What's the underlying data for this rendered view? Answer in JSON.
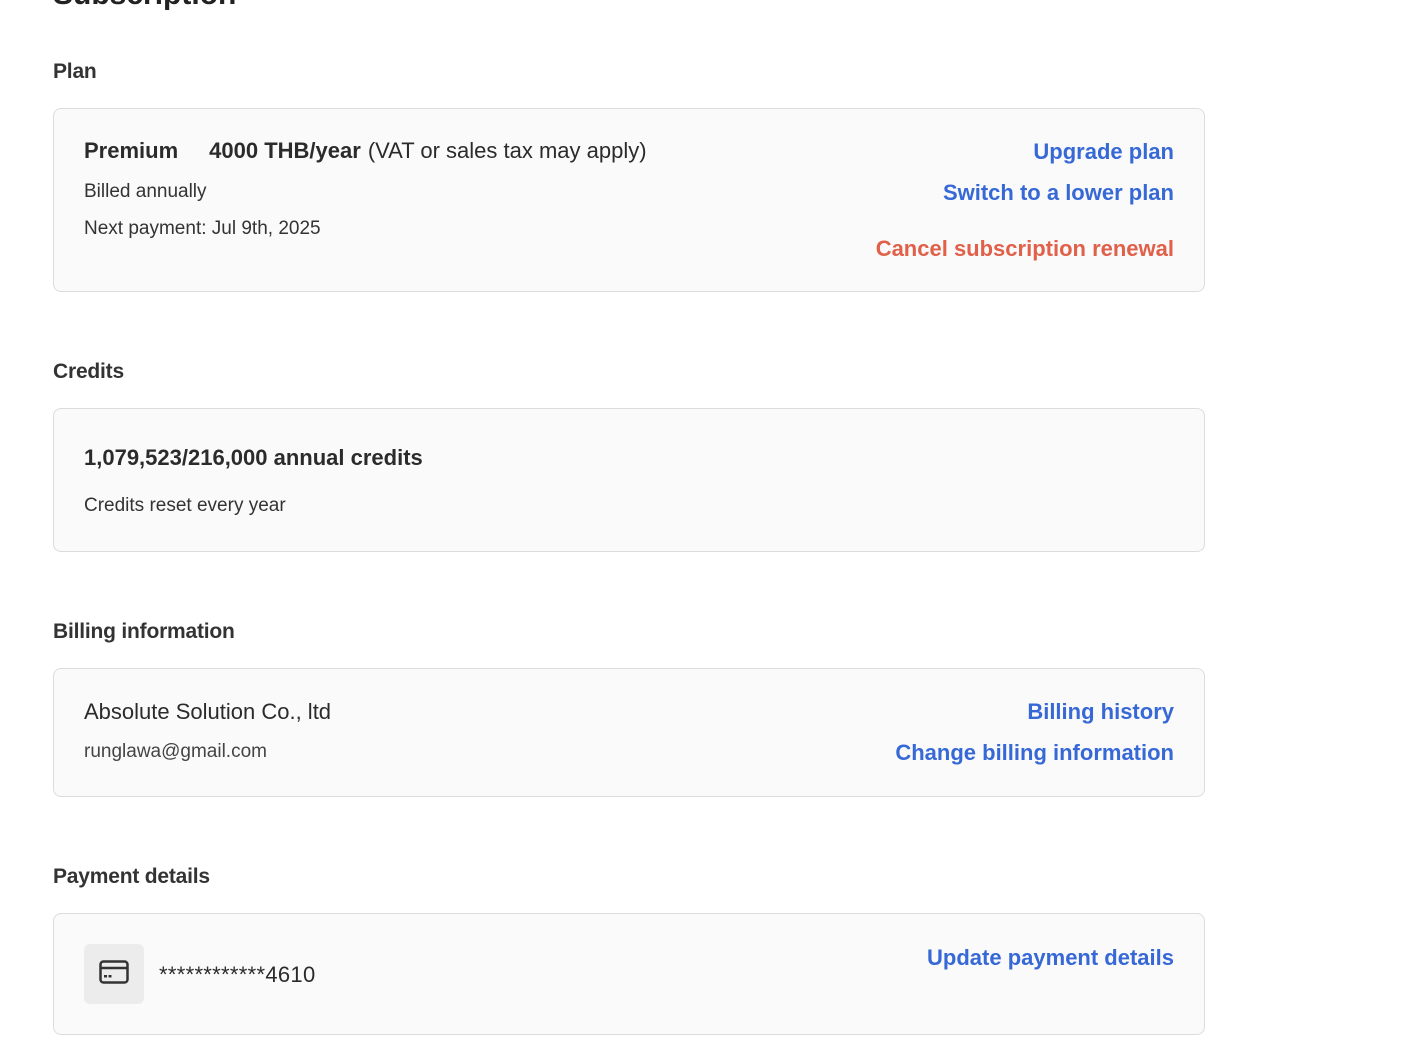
{
  "page": {
    "title": "Subscription"
  },
  "plan": {
    "section_title": "Plan",
    "name": "Premium",
    "price": "4000 THB/year",
    "tax_note": "(VAT or sales tax may apply)",
    "billing_cycle": "Billed annually",
    "next_payment": "Next payment: Jul 9th, 2025",
    "upgrade_label": "Upgrade plan",
    "downgrade_label": "Switch to a lower plan",
    "cancel_label": "Cancel subscription renewal"
  },
  "credits": {
    "section_title": "Credits",
    "summary": "1,079,523/216,000 annual credits",
    "reset_note": "Credits reset every year"
  },
  "billing": {
    "section_title": "Billing information",
    "company": "Absolute Solution Co., ltd",
    "email": "runglawa@gmail.com",
    "history_label": "Billing history",
    "change_label": "Change billing information"
  },
  "payment": {
    "section_title": "Payment details",
    "card_icon": "credit-card-icon",
    "card_number": "************4610",
    "update_label": "Update payment details"
  },
  "colors": {
    "link": "#3668d6",
    "danger": "#e0604a",
    "card_bg": "#fafafa",
    "card_border": "#dcdcdc"
  }
}
